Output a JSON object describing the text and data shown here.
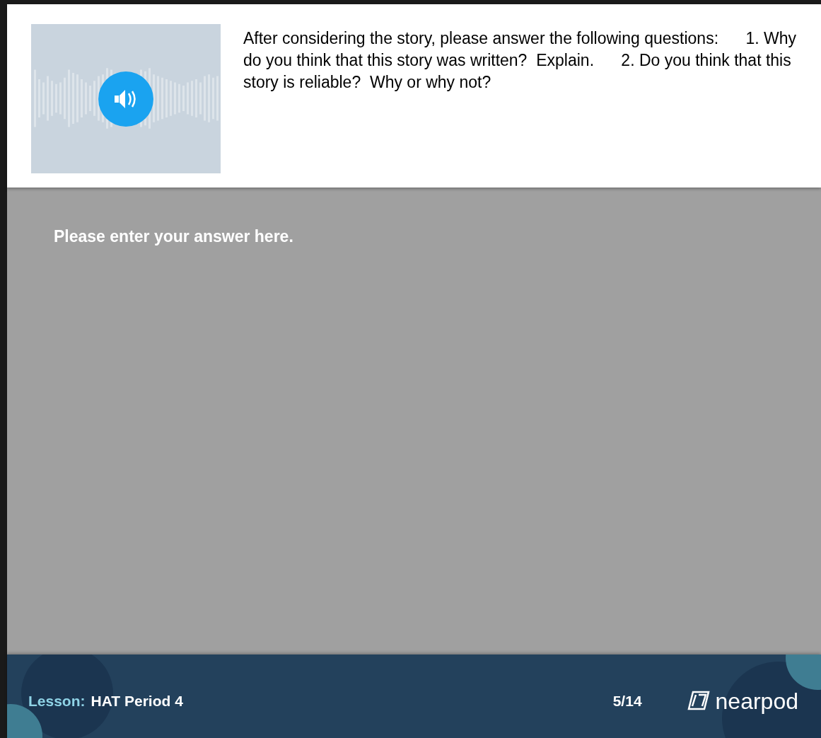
{
  "question": {
    "text": "After considering the story, please answer the following questions:      1. Why do you think that this story was written?  Explain.      2. Do you think that this story is reliable?  Why or why not?"
  },
  "answer": {
    "placeholder": "Please enter your answer here."
  },
  "footer": {
    "lesson_label": "Lesson:",
    "lesson_name": "HAT Period 4",
    "progress": "5/14",
    "logo": "nearpod"
  }
}
